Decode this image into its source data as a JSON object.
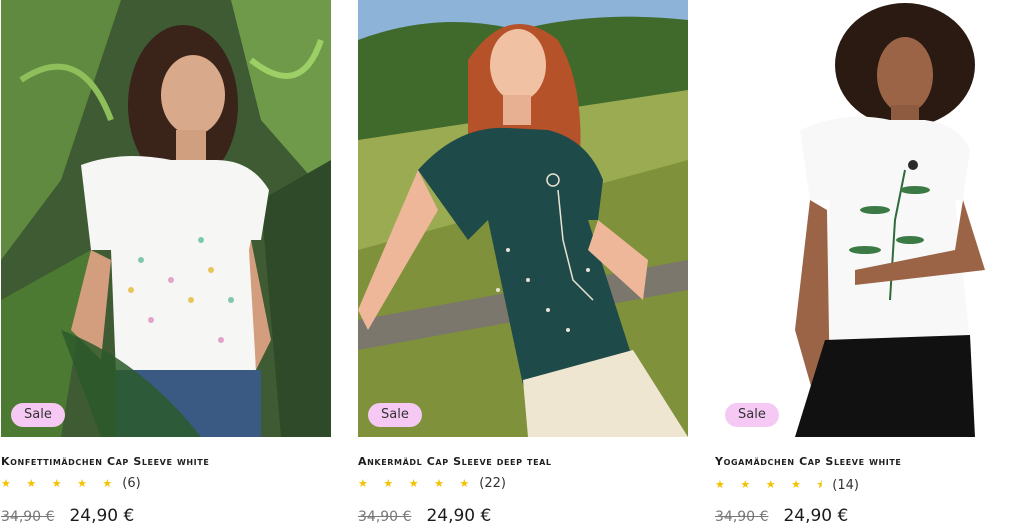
{
  "products": [
    {
      "badge": "Sale",
      "title": "Konfettimädchen Cap Sleeve white",
      "stars": "★ ★ ★ ★ ★",
      "rating": 5,
      "reviews": "(6)",
      "old_price": "34,90 €",
      "price": "24,90 €",
      "shirt_color": "#f6f6f4"
    },
    {
      "badge": "Sale",
      "title": "Ankermädl Cap Sleeve deep teal",
      "stars": "★ ★ ★ ★ ★",
      "rating": 5,
      "reviews": "(22)",
      "old_price": "34,90 €",
      "price": "24,90 €",
      "shirt_color": "#1f4a4a"
    },
    {
      "badge": "Sale",
      "title": "Yogamädchen Cap Sleeve white",
      "stars": "★ ★ ★ ★ ⯨",
      "rating": 4.5,
      "reviews": "(14)",
      "old_price": "34,90 €",
      "price": "24,90 €",
      "shirt_color": "#f8f8f8"
    }
  ],
  "colors": {
    "badge_bg": "#f6c9f4",
    "star": "#f2c200"
  }
}
